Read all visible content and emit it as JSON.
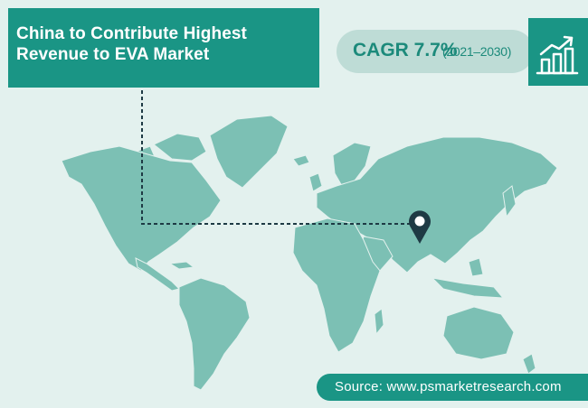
{
  "title": "China to Contribute Highest Revenue to EVA Market",
  "cagr": {
    "label": "CAGR 7.7%",
    "period": "(2021–2030)"
  },
  "source": "Source: www.psmarketresearch.com",
  "marker": {
    "region": "China",
    "icon": "map-pin-icon"
  },
  "chart_icon": "growth-chart-icon",
  "colors": {
    "background": "#e3f1ee",
    "accent": "#1a9585",
    "land": "#7cc0b4",
    "pill": "#bedcd6",
    "marker": "#1e3a44"
  }
}
